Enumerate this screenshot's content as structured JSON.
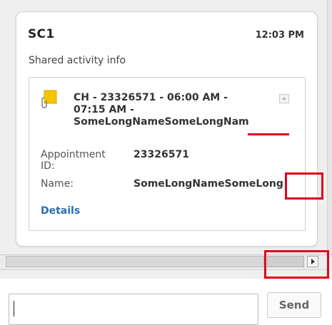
{
  "card": {
    "title": "SC1",
    "time": "12:03 PM",
    "subtitle": "Shared activity info"
  },
  "activity": {
    "icon": "note-attachment-icon",
    "title_line1": "CH - 23326571 - 06:00 AM -",
    "title_line2": "07:15 AM -",
    "title_line3": "SomeLongNameSomeLongNam",
    "fields": [
      {
        "label": "Appointment ID:",
        "value": "23326571"
      },
      {
        "label": "Name:",
        "value": "SomeLongNameSomeLong"
      }
    ],
    "details_link": "Details"
  },
  "compose": {
    "input_value": "",
    "send_label": "Send"
  },
  "colors": {
    "highlight": "#e0001a",
    "link": "#2a6fb0",
    "note_icon": "#f5c400"
  }
}
